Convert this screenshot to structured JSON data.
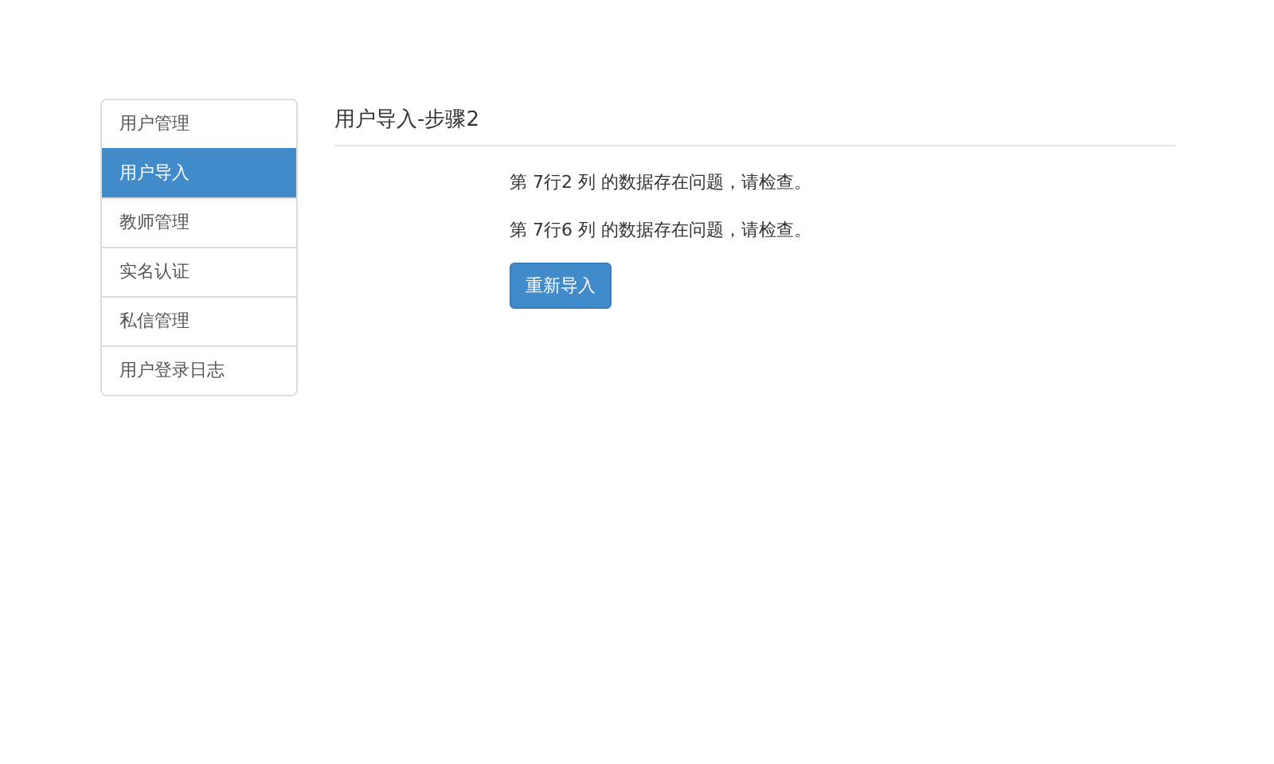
{
  "sidebar": {
    "items": [
      {
        "label": "用户管理",
        "selected": false
      },
      {
        "label": "用户导入",
        "selected": true
      },
      {
        "label": "教师管理",
        "selected": false
      },
      {
        "label": "实名认证",
        "selected": false
      },
      {
        "label": "私信管理",
        "selected": false
      },
      {
        "label": "用户登录日志",
        "selected": false
      }
    ]
  },
  "heading": "用户导入-步骤2",
  "messages": [
    "第 7行2 列 的数据存在问题，请检查。",
    "第 7行6 列 的数据存在问题，请检查。"
  ],
  "button": "重新导入"
}
